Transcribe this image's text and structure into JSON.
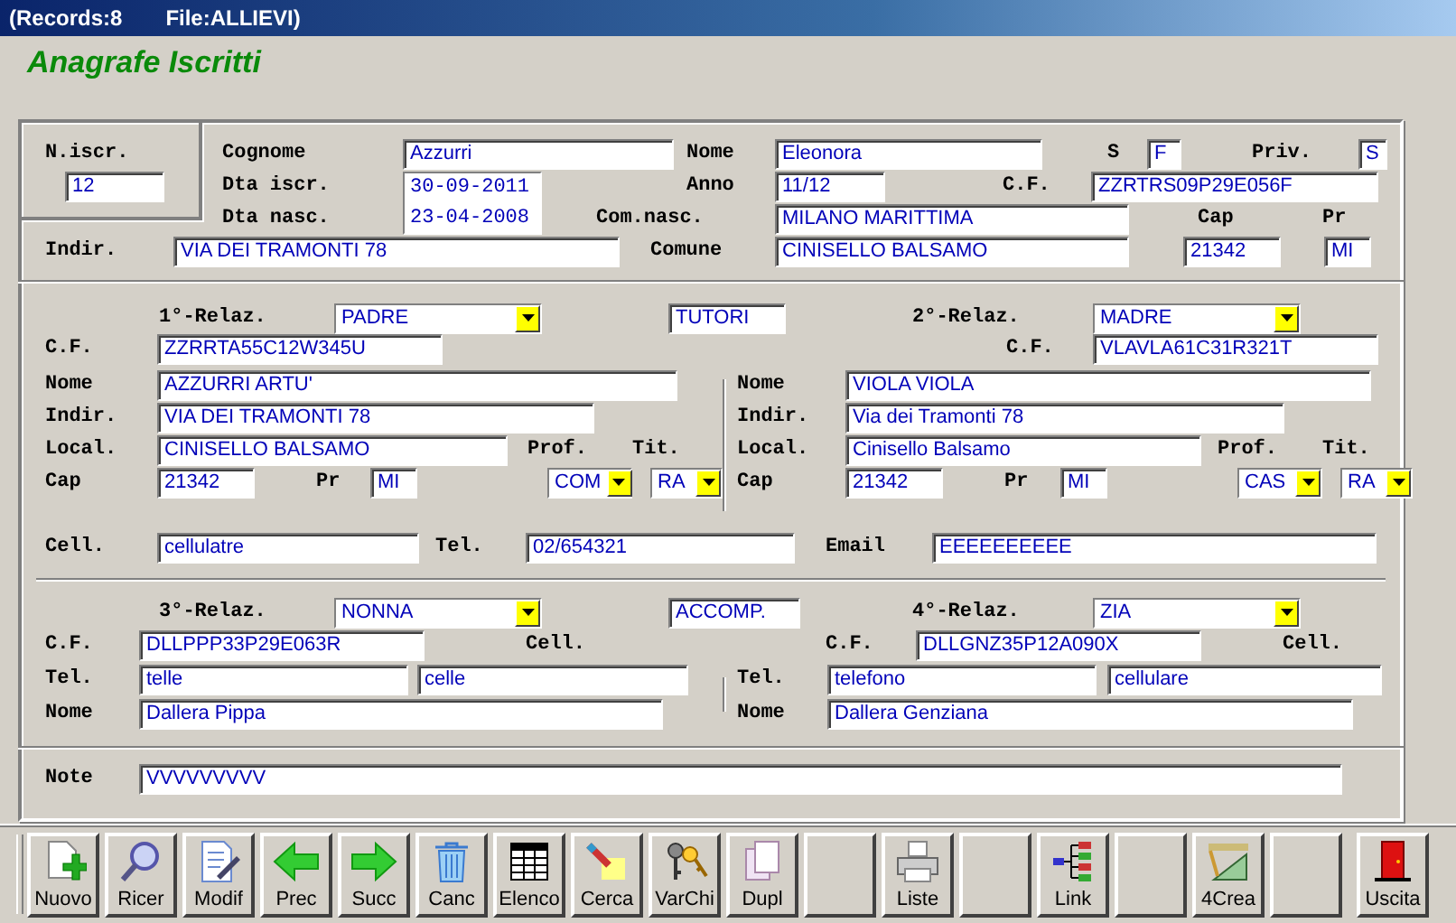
{
  "title_bar": {
    "records": "(Records:8",
    "file": "File:ALLIEVI)"
  },
  "form_title": "Anagrafe Iscritti",
  "sections": [
    {
      "lines": [
        {
          "controls": [
            {
              "kind": "label",
              "text": "N.iscr."
            },
            {
              "kind": "label",
              "text": "Cognome"
            },
            {
              "kind": "field",
              "value": "Azzurri"
            },
            {
              "kind": "label",
              "text": "Nome"
            },
            {
              "kind": "field",
              "value": "Eleonora"
            },
            {
              "kind": "label",
              "text": "S"
            },
            {
              "kind": "field",
              "value": "F"
            },
            {
              "kind": "label",
              "text": "Priv."
            },
            {
              "kind": "field",
              "value": "S"
            }
          ]
        },
        {
          "controls": [
            {
              "kind": "field",
              "value": "12"
            },
            {
              "kind": "label",
              "text": "Dta iscr."
            },
            {
              "kind": "dates",
              "values": [
                "30-09-2011",
                "23-04-2008"
              ]
            },
            {
              "kind": "label",
              "text": "Anno"
            },
            {
              "kind": "field",
              "value": "11/12"
            },
            {
              "kind": "label",
              "text": "C.F."
            },
            {
              "kind": "field",
              "value": "ZZRTRS09P29E056F"
            }
          ]
        },
        {
          "controls": [
            {
              "kind": "label",
              "text": "Dta nasc."
            },
            {
              "kind": "label",
              "text": "Com.nasc."
            },
            {
              "kind": "field",
              "value": "MILANO MARITTIMA"
            },
            {
              "kind": "label",
              "text": "Cap"
            },
            {
              "kind": "label",
              "text": "Pr"
            }
          ]
        },
        {
          "controls": [
            {
              "kind": "label",
              "text": "Indir."
            },
            {
              "kind": "field",
              "value": "VIA DEI TRAMONTI 78"
            },
            {
              "kind": "label",
              "text": "Comune"
            },
            {
              "kind": "field",
              "value": "CINISELLO BALSAMO"
            },
            {
              "kind": "field",
              "value": "21342"
            },
            {
              "kind": "field",
              "value": "MI"
            }
          ]
        }
      ]
    },
    {
      "lines": [
        {
          "controls": [
            {
              "kind": "label",
              "text": "1°-Relaz."
            },
            {
              "kind": "combo",
              "value": "PADRE"
            },
            {
              "kind": "field",
              "value": "TUTORI"
            },
            {
              "kind": "label",
              "text": "2°-Relaz."
            },
            {
              "kind": "combo",
              "value": "MADRE"
            }
          ]
        },
        {
          "controls": [
            {
              "kind": "label",
              "text": "C.F."
            },
            {
              "kind": "field",
              "value": "ZZRRTA55C12W345U"
            },
            {
              "kind": "label",
              "text": "C.F."
            },
            {
              "kind": "field",
              "value": "VLAVLA61C31R321T"
            }
          ]
        },
        {
          "controls": [
            {
              "kind": "label",
              "text": "Nome"
            },
            {
              "kind": "field",
              "value": "AZZURRI ARTU'"
            },
            {
              "kind": "label",
              "text": "Nome"
            },
            {
              "kind": "field",
              "value": "VIOLA VIOLA"
            }
          ]
        },
        {
          "controls": [
            {
              "kind": "label",
              "text": "Indir."
            },
            {
              "kind": "field",
              "value": "VIA DEI TRAMONTI 78"
            },
            {
              "kind": "label",
              "text": "Indir."
            },
            {
              "kind": "field",
              "value": "Via dei Tramonti 78"
            }
          ]
        },
        {
          "controls": [
            {
              "kind": "label",
              "text": "Local."
            },
            {
              "kind": "field",
              "value": "CINISELLO BALSAMO"
            },
            {
              "kind": "label",
              "text": "Prof."
            },
            {
              "kind": "label",
              "text": "Tit."
            },
            {
              "kind": "label",
              "text": "Local."
            },
            {
              "kind": "field",
              "value": "Cinisello Balsamo"
            },
            {
              "kind": "label",
              "text": "Prof."
            },
            {
              "kind": "label",
              "text": "Tit."
            }
          ]
        },
        {
          "controls": [
            {
              "kind": "label",
              "text": "Cap"
            },
            {
              "kind": "field",
              "value": "21342"
            },
            {
              "kind": "label",
              "text": "Pr"
            },
            {
              "kind": "field",
              "value": "MI"
            },
            {
              "kind": "combo",
              "value": "COM"
            },
            {
              "kind": "combo",
              "value": "RA"
            },
            {
              "kind": "label",
              "text": "Cap"
            },
            {
              "kind": "field",
              "value": "21342"
            },
            {
              "kind": "label",
              "text": "Pr"
            },
            {
              "kind": "field",
              "value": "MI"
            },
            {
              "kind": "combo",
              "value": "CAS"
            },
            {
              "kind": "combo",
              "value": "RA"
            }
          ]
        },
        {
          "controls": [
            {
              "kind": "label",
              "text": "Cell."
            },
            {
              "kind": "field",
              "value": "cellulatre"
            },
            {
              "kind": "label",
              "text": "Tel."
            },
            {
              "kind": "field",
              "value": "02/654321"
            },
            {
              "kind": "label",
              "text": "Email"
            },
            {
              "kind": "field",
              "value": "EEEEEEEEEE"
            }
          ]
        }
      ]
    },
    {
      "lines": [
        {
          "controls": [
            {
              "kind": "label",
              "text": "3°-Relaz."
            },
            {
              "kind": "combo",
              "value": "NONNA"
            },
            {
              "kind": "field",
              "value": "ACCOMP."
            },
            {
              "kind": "label",
              "text": "4°-Relaz."
            },
            {
              "kind": "combo",
              "value": "ZIA"
            }
          ]
        },
        {
          "controls": [
            {
              "kind": "label",
              "text": "C.F."
            },
            {
              "kind": "field",
              "value": "DLLPPP33P29E063R"
            },
            {
              "kind": "label",
              "text": "Cell."
            },
            {
              "kind": "label",
              "text": "C.F."
            },
            {
              "kind": "field",
              "value": "DLLGNZ35P12A090X"
            },
            {
              "kind": "label",
              "text": "Cell."
            }
          ]
        },
        {
          "controls": [
            {
              "kind": "label",
              "text": "Tel."
            },
            {
              "kind": "field",
              "value": "telle"
            },
            {
              "kind": "field",
              "value": "celle"
            },
            {
              "kind": "label",
              "text": "Tel."
            },
            {
              "kind": "field",
              "value": "telefono"
            },
            {
              "kind": "field",
              "value": "cellulare"
            }
          ]
        },
        {
          "controls": [
            {
              "kind": "label",
              "text": "Nome"
            },
            {
              "kind": "field",
              "value": "Dallera Pippa"
            },
            {
              "kind": "label",
              "text": "Nome"
            },
            {
              "kind": "field",
              "value": "Dallera Genziana"
            }
          ]
        }
      ]
    },
    {
      "lines": [
        {
          "controls": [
            {
              "kind": "label",
              "text": "Note"
            },
            {
              "kind": "field",
              "value": "VVVVVVVVV"
            }
          ]
        }
      ]
    }
  ],
  "toolbar": [
    {
      "kind": "tool",
      "label": "Nuovo"
    },
    {
      "kind": "tool",
      "label": "Ricer"
    },
    {
      "kind": "tool",
      "label": "Modif"
    },
    {
      "kind": "tool",
      "label": "Prec"
    },
    {
      "kind": "tool",
      "label": "Succ"
    },
    {
      "kind": "tool",
      "label": "Canc"
    },
    {
      "kind": "tool",
      "label": "Elenco"
    },
    {
      "kind": "tool",
      "label": "Cerca"
    },
    {
      "kind": "tool",
      "label": "VarChi"
    },
    {
      "kind": "tool",
      "label": "Dupl"
    },
    {
      "kind": "blank"
    },
    {
      "kind": "tool",
      "label": "Liste"
    },
    {
      "kind": "blank"
    },
    {
      "kind": "tool",
      "label": "Link"
    },
    {
      "kind": "blank"
    },
    {
      "kind": "tool",
      "label": "4Crea"
    },
    {
      "kind": "blank"
    },
    {
      "kind": "tool",
      "label": "Uscita"
    }
  ]
}
